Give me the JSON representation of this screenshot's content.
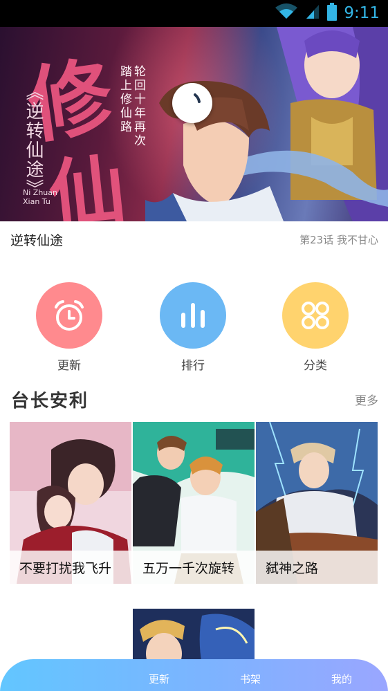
{
  "status_bar": {
    "time": "9:11",
    "icons": [
      "wifi-icon",
      "signal-icon",
      "battery-icon"
    ],
    "color": "#33b5e5"
  },
  "banner": {
    "big_chars": [
      "修",
      "仙"
    ],
    "vertical_title": "《逆转仙途》",
    "tagline_col1": "踏上修仙路",
    "tagline_col2": "轮回十年再次",
    "pinyin": "Ni Zhuan Xian Tu",
    "loading": true
  },
  "featured": {
    "title": "逆转仙途",
    "episode": "第23话 我不甘心"
  },
  "quick_nav": [
    {
      "label": "更新",
      "icon": "alarm-clock-icon",
      "color": "#ff8a8e"
    },
    {
      "label": "排行",
      "icon": "bar-chart-icon",
      "color": "#6bb8f4"
    },
    {
      "label": "分类",
      "icon": "grid-circles-icon",
      "color": "#ffd36e"
    }
  ],
  "section": {
    "title": "台长安利",
    "more": "更多"
  },
  "cards": [
    {
      "title": "不要打扰我飞升"
    },
    {
      "title": "五万一千次旋转"
    },
    {
      "title": "弑神之路"
    }
  ],
  "bottom_nav": {
    "items": [
      "更新",
      "书架",
      "我的"
    ]
  }
}
